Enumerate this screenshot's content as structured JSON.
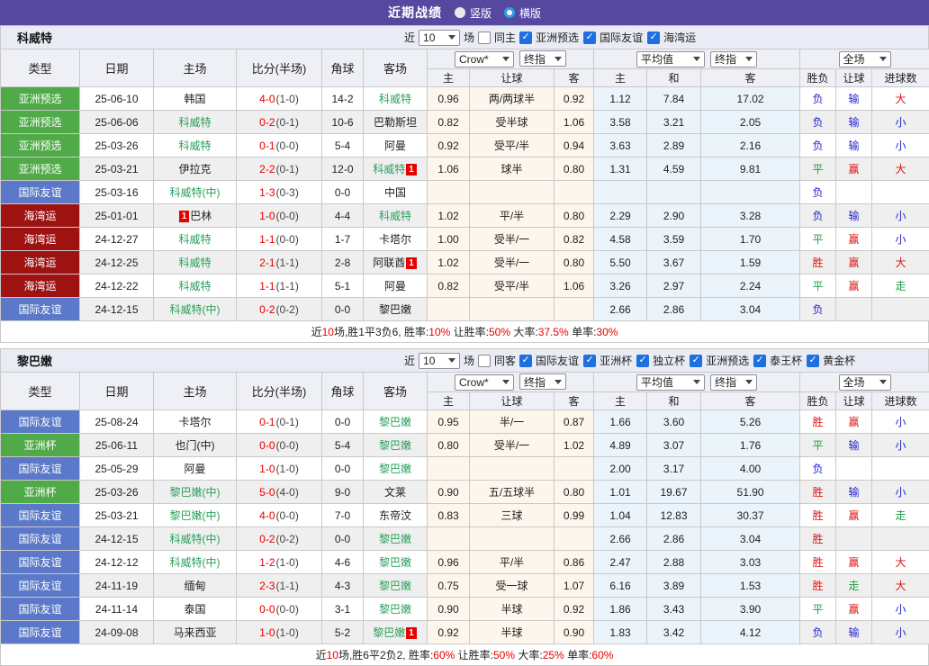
{
  "title_bar": {
    "title": "近期战绩",
    "radio_vertical": "竖版",
    "radio_horizontal": "横版"
  },
  "filter_labels": {
    "near": "近",
    "count": "10",
    "games": "场"
  },
  "column_headers": {
    "main": [
      "类型",
      "日期",
      "主场",
      "比分(半场)",
      "角球",
      "客场"
    ],
    "sub": [
      "主",
      "让球",
      "客",
      "主",
      "和",
      "客",
      "胜负",
      "让球",
      "进球数"
    ]
  },
  "dropdowns": {
    "book": "Crow*",
    "book_final": "终指",
    "avg": "平均值",
    "avg_final": "终指",
    "scope": "全场"
  },
  "tables": [
    {
      "team": "科威特",
      "same_label": "同主",
      "competitions": [
        "亚洲预选",
        "国际友谊",
        "海湾运"
      ],
      "rows": [
        {
          "type": "亚洲预选",
          "type_color": "green",
          "date": "25-06-10",
          "home": "韩国",
          "home_green": false,
          "home_badge_pre": "",
          "home_badge_post": "",
          "score": "4-0",
          "half": "(1-0)",
          "corner": "14-2",
          "away": "科威特",
          "away_green": true,
          "away_badge_pre": "",
          "away_badge_post": "",
          "odds_home": "0.96",
          "odds_handicap": "两/两球半",
          "odds_away": "0.92",
          "avg_home": "1.12",
          "avg_draw": "7.84",
          "avg_away": "17.02",
          "result": "负",
          "result_color": "blue",
          "handicap_result": "输",
          "handicap_result_color": "blue",
          "goals": "大",
          "goals_color": "red"
        },
        {
          "type": "亚洲预选",
          "type_color": "green",
          "date": "25-06-06",
          "home": "科威特",
          "home_green": true,
          "home_badge_pre": "",
          "home_badge_post": "",
          "score": "0-2",
          "half": "(0-1)",
          "corner": "10-6",
          "away": "巴勒斯坦",
          "away_green": false,
          "away_badge_pre": "",
          "away_badge_post": "",
          "odds_home": "0.82",
          "odds_handicap": "受半球",
          "odds_away": "1.06",
          "avg_home": "3.58",
          "avg_draw": "3.21",
          "avg_away": "2.05",
          "result": "负",
          "result_color": "blue",
          "handicap_result": "输",
          "handicap_result_color": "blue",
          "goals": "小",
          "goals_color": "blue"
        },
        {
          "type": "亚洲预选",
          "type_color": "green",
          "date": "25-03-26",
          "home": "科威特",
          "home_green": true,
          "home_badge_pre": "",
          "home_badge_post": "",
          "score": "0-1",
          "half": "(0-0)",
          "corner": "5-4",
          "away": "阿曼",
          "away_green": false,
          "away_badge_pre": "",
          "away_badge_post": "",
          "odds_home": "0.92",
          "odds_handicap": "受平/半",
          "odds_away": "0.94",
          "avg_home": "3.63",
          "avg_draw": "2.89",
          "avg_away": "2.16",
          "result": "负",
          "result_color": "blue",
          "handicap_result": "输",
          "handicap_result_color": "blue",
          "goals": "小",
          "goals_color": "blue"
        },
        {
          "type": "亚洲预选",
          "type_color": "green",
          "date": "25-03-21",
          "home": "伊拉克",
          "home_green": false,
          "home_badge_pre": "",
          "home_badge_post": "",
          "score": "2-2",
          "half": "(0-1)",
          "corner": "12-0",
          "away": "科威特",
          "away_green": true,
          "away_badge_pre": "",
          "away_badge_post": "1",
          "odds_home": "1.06",
          "odds_handicap": "球半",
          "odds_away": "0.80",
          "avg_home": "1.31",
          "avg_draw": "4.59",
          "avg_away": "9.81",
          "result": "平",
          "result_color": "green",
          "handicap_result": "赢",
          "handicap_result_color": "red",
          "goals": "大",
          "goals_color": "red"
        },
        {
          "type": "国际友谊",
          "type_color": "blue",
          "date": "25-03-16",
          "home": "科威特(中)",
          "home_green": true,
          "home_badge_pre": "",
          "home_badge_post": "",
          "score": "1-3",
          "half": "(0-3)",
          "corner": "0-0",
          "away": "中国",
          "away_green": false,
          "away_badge_pre": "",
          "away_badge_post": "",
          "odds_home": "",
          "odds_handicap": "",
          "odds_away": "",
          "avg_home": "",
          "avg_draw": "",
          "avg_away": "",
          "result": "负",
          "result_color": "blue",
          "handicap_result": "",
          "handicap_result_color": "blue",
          "goals": "",
          "goals_color": "blue"
        },
        {
          "type": "海湾运",
          "type_color": "darkred",
          "date": "25-01-01",
          "home": "巴林",
          "home_green": false,
          "home_badge_pre": "1",
          "home_badge_post": "",
          "score": "1-0",
          "half": "(0-0)",
          "corner": "4-4",
          "away": "科威特",
          "away_green": true,
          "away_badge_pre": "",
          "away_badge_post": "",
          "odds_home": "1.02",
          "odds_handicap": "平/半",
          "odds_away": "0.80",
          "avg_home": "2.29",
          "avg_draw": "2.90",
          "avg_away": "3.28",
          "result": "负",
          "result_color": "blue",
          "handicap_result": "输",
          "handicap_result_color": "blue",
          "goals": "小",
          "goals_color": "blue"
        },
        {
          "type": "海湾运",
          "type_color": "darkred",
          "date": "24-12-27",
          "home": "科威特",
          "home_green": true,
          "home_badge_pre": "",
          "home_badge_post": "",
          "score": "1-1",
          "half": "(0-0)",
          "corner": "1-7",
          "away": "卡塔尔",
          "away_green": false,
          "away_badge_pre": "",
          "away_badge_post": "",
          "odds_home": "1.00",
          "odds_handicap": "受半/一",
          "odds_away": "0.82",
          "avg_home": "4.58",
          "avg_draw": "3.59",
          "avg_away": "1.70",
          "result": "平",
          "result_color": "green",
          "handicap_result": "赢",
          "handicap_result_color": "red",
          "goals": "小",
          "goals_color": "blue"
        },
        {
          "type": "海湾运",
          "type_color": "darkred",
          "date": "24-12-25",
          "home": "科威特",
          "home_green": true,
          "home_badge_pre": "",
          "home_badge_post": "",
          "score": "2-1",
          "half": "(1-1)",
          "corner": "2-8",
          "away": "阿联酋",
          "away_green": false,
          "away_badge_pre": "",
          "away_badge_post": "1",
          "odds_home": "1.02",
          "odds_handicap": "受半/一",
          "odds_away": "0.80",
          "avg_home": "5.50",
          "avg_draw": "3.67",
          "avg_away": "1.59",
          "result": "胜",
          "result_color": "red",
          "handicap_result": "赢",
          "handicap_result_color": "red",
          "goals": "大",
          "goals_color": "red"
        },
        {
          "type": "海湾运",
          "type_color": "darkred",
          "date": "24-12-22",
          "home": "科威特",
          "home_green": true,
          "home_badge_pre": "",
          "home_badge_post": "",
          "score": "1-1",
          "half": "(1-1)",
          "corner": "5-1",
          "away": "阿曼",
          "away_green": false,
          "away_badge_pre": "",
          "away_badge_post": "",
          "odds_home": "0.82",
          "odds_handicap": "受平/半",
          "odds_away": "1.06",
          "avg_home": "3.26",
          "avg_draw": "2.97",
          "avg_away": "2.24",
          "result": "平",
          "result_color": "green",
          "handicap_result": "赢",
          "handicap_result_color": "red",
          "goals": "走",
          "goals_color": "green"
        },
        {
          "type": "国际友谊",
          "type_color": "blue",
          "date": "24-12-15",
          "home": "科威特(中)",
          "home_green": true,
          "home_badge_pre": "",
          "home_badge_post": "",
          "score": "0-2",
          "half": "(0-2)",
          "corner": "0-0",
          "away": "黎巴嫩",
          "away_green": false,
          "away_badge_pre": "",
          "away_badge_post": "",
          "odds_home": "",
          "odds_handicap": "",
          "odds_away": "",
          "avg_home": "2.66",
          "avg_draw": "2.86",
          "avg_away": "3.04",
          "result": "负",
          "result_color": "blue",
          "handicap_result": "",
          "handicap_result_color": "blue",
          "goals": "",
          "goals_color": "blue"
        }
      ],
      "summary": [
        {
          "t": "近",
          "c": "k"
        },
        {
          "t": "10",
          "c": "r"
        },
        {
          "t": "场,胜1平3负6, 胜率:",
          "c": "k"
        },
        {
          "t": "10%",
          "c": "r"
        },
        {
          "t": " 让胜率:",
          "c": "k"
        },
        {
          "t": "50%",
          "c": "r"
        },
        {
          "t": " 大率:",
          "c": "k"
        },
        {
          "t": "37.5%",
          "c": "r"
        },
        {
          "t": " 单率:",
          "c": "k"
        },
        {
          "t": "30%",
          "c": "r"
        }
      ]
    },
    {
      "team": "黎巴嫩",
      "same_label": "同客",
      "competitions": [
        "国际友谊",
        "亚洲杯",
        "独立杯",
        "亚洲预选",
        "泰王杯",
        "黄金杯"
      ],
      "rows": [
        {
          "type": "国际友谊",
          "type_color": "blue",
          "date": "25-08-24",
          "home": "卡塔尔",
          "home_green": false,
          "home_badge_pre": "",
          "home_badge_post": "",
          "score": "0-1",
          "half": "(0-1)",
          "corner": "0-0",
          "away": "黎巴嫩",
          "away_green": true,
          "away_badge_pre": "",
          "away_badge_post": "",
          "odds_home": "0.95",
          "odds_handicap": "半/一",
          "odds_away": "0.87",
          "avg_home": "1.66",
          "avg_draw": "3.60",
          "avg_away": "5.26",
          "result": "胜",
          "result_color": "red",
          "handicap_result": "赢",
          "handicap_result_color": "red",
          "goals": "小",
          "goals_color": "blue"
        },
        {
          "type": "亚洲杯",
          "type_color": "green",
          "date": "25-06-11",
          "home": "也门(中)",
          "home_green": false,
          "home_badge_pre": "",
          "home_badge_post": "",
          "score": "0-0",
          "half": "(0-0)",
          "corner": "5-4",
          "away": "黎巴嫩",
          "away_green": true,
          "away_badge_pre": "",
          "away_badge_post": "",
          "odds_home": "0.80",
          "odds_handicap": "受半/一",
          "odds_away": "1.02",
          "avg_home": "4.89",
          "avg_draw": "3.07",
          "avg_away": "1.76",
          "result": "平",
          "result_color": "green",
          "handicap_result": "输",
          "handicap_result_color": "blue",
          "goals": "小",
          "goals_color": "blue"
        },
        {
          "type": "国际友谊",
          "type_color": "blue",
          "date": "25-05-29",
          "home": "阿曼",
          "home_green": false,
          "home_badge_pre": "",
          "home_badge_post": "",
          "score": "1-0",
          "half": "(1-0)",
          "corner": "0-0",
          "away": "黎巴嫩",
          "away_green": true,
          "away_badge_pre": "",
          "away_badge_post": "",
          "odds_home": "",
          "odds_handicap": "",
          "odds_away": "",
          "avg_home": "2.00",
          "avg_draw": "3.17",
          "avg_away": "4.00",
          "result": "负",
          "result_color": "blue",
          "handicap_result": "",
          "handicap_result_color": "blue",
          "goals": "",
          "goals_color": "blue"
        },
        {
          "type": "亚洲杯",
          "type_color": "green",
          "date": "25-03-26",
          "home": "黎巴嫩(中)",
          "home_green": true,
          "home_badge_pre": "",
          "home_badge_post": "",
          "score": "5-0",
          "half": "(4-0)",
          "corner": "9-0",
          "away": "文莱",
          "away_green": false,
          "away_badge_pre": "",
          "away_badge_post": "",
          "odds_home": "0.90",
          "odds_handicap": "五/五球半",
          "odds_away": "0.80",
          "avg_home": "1.01",
          "avg_draw": "19.67",
          "avg_away": "51.90",
          "result": "胜",
          "result_color": "red",
          "handicap_result": "输",
          "handicap_result_color": "blue",
          "goals": "小",
          "goals_color": "blue"
        },
        {
          "type": "国际友谊",
          "type_color": "blue",
          "date": "25-03-21",
          "home": "黎巴嫩(中)",
          "home_green": true,
          "home_badge_pre": "",
          "home_badge_post": "",
          "score": "4-0",
          "half": "(0-0)",
          "corner": "7-0",
          "away": "东帝汶",
          "away_green": false,
          "away_badge_pre": "",
          "away_badge_post": "",
          "odds_home": "0.83",
          "odds_handicap": "三球",
          "odds_away": "0.99",
          "avg_home": "1.04",
          "avg_draw": "12.83",
          "avg_away": "30.37",
          "result": "胜",
          "result_color": "red",
          "handicap_result": "赢",
          "handicap_result_color": "red",
          "goals": "走",
          "goals_color": "green"
        },
        {
          "type": "国际友谊",
          "type_color": "blue",
          "date": "24-12-15",
          "home": "科威特(中)",
          "home_green": true,
          "home_badge_pre": "",
          "home_badge_post": "",
          "score": "0-2",
          "half": "(0-2)",
          "corner": "0-0",
          "away": "黎巴嫩",
          "away_green": true,
          "away_badge_pre": "",
          "away_badge_post": "",
          "odds_home": "",
          "odds_handicap": "",
          "odds_away": "",
          "avg_home": "2.66",
          "avg_draw": "2.86",
          "avg_away": "3.04",
          "result": "胜",
          "result_color": "red",
          "handicap_result": "",
          "handicap_result_color": "blue",
          "goals": "",
          "goals_color": "blue"
        },
        {
          "type": "国际友谊",
          "type_color": "blue",
          "date": "24-12-12",
          "home": "科威特(中)",
          "home_green": true,
          "home_badge_pre": "",
          "home_badge_post": "",
          "score": "1-2",
          "half": "(1-0)",
          "corner": "4-6",
          "away": "黎巴嫩",
          "away_green": true,
          "away_badge_pre": "",
          "away_badge_post": "",
          "odds_home": "0.96",
          "odds_handicap": "平/半",
          "odds_away": "0.86",
          "avg_home": "2.47",
          "avg_draw": "2.88",
          "avg_away": "3.03",
          "result": "胜",
          "result_color": "red",
          "handicap_result": "赢",
          "handicap_result_color": "red",
          "goals": "大",
          "goals_color": "red"
        },
        {
          "type": "国际友谊",
          "type_color": "blue",
          "date": "24-11-19",
          "home": "缅甸",
          "home_green": false,
          "home_badge_pre": "",
          "home_badge_post": "",
          "score": "2-3",
          "half": "(1-1)",
          "corner": "4-3",
          "away": "黎巴嫩",
          "away_green": true,
          "away_badge_pre": "",
          "away_badge_post": "",
          "odds_home": "0.75",
          "odds_handicap": "受一球",
          "odds_away": "1.07",
          "avg_home": "6.16",
          "avg_draw": "3.89",
          "avg_away": "1.53",
          "result": "胜",
          "result_color": "red",
          "handicap_result": "走",
          "handicap_result_color": "green",
          "goals": "大",
          "goals_color": "red"
        },
        {
          "type": "国际友谊",
          "type_color": "blue",
          "date": "24-11-14",
          "home": "泰国",
          "home_green": false,
          "home_badge_pre": "",
          "home_badge_post": "",
          "score": "0-0",
          "half": "(0-0)",
          "corner": "3-1",
          "away": "黎巴嫩",
          "away_green": true,
          "away_badge_pre": "",
          "away_badge_post": "",
          "odds_home": "0.90",
          "odds_handicap": "半球",
          "odds_away": "0.92",
          "avg_home": "1.86",
          "avg_draw": "3.43",
          "avg_away": "3.90",
          "result": "平",
          "result_color": "green",
          "handicap_result": "赢",
          "handicap_result_color": "red",
          "goals": "小",
          "goals_color": "blue"
        },
        {
          "type": "国际友谊",
          "type_color": "blue",
          "date": "24-09-08",
          "home": "马来西亚",
          "home_green": false,
          "home_badge_pre": "",
          "home_badge_post": "",
          "score": "1-0",
          "half": "(1-0)",
          "corner": "5-2",
          "away": "黎巴嫩",
          "away_green": true,
          "away_badge_pre": "",
          "away_badge_post": "1",
          "odds_home": "0.92",
          "odds_handicap": "半球",
          "odds_away": "0.90",
          "avg_home": "1.83",
          "avg_draw": "3.42",
          "avg_away": "4.12",
          "result": "负",
          "result_color": "blue",
          "handicap_result": "输",
          "handicap_result_color": "blue",
          "goals": "小",
          "goals_color": "blue"
        }
      ],
      "summary": [
        {
          "t": "近",
          "c": "k"
        },
        {
          "t": "10",
          "c": "r"
        },
        {
          "t": "场,胜6平2负2, 胜率:",
          "c": "k"
        },
        {
          "t": "60%",
          "c": "r"
        },
        {
          "t": " 让胜率:",
          "c": "k"
        },
        {
          "t": "50%",
          "c": "r"
        },
        {
          "t": " 大率:",
          "c": "k"
        },
        {
          "t": "25%",
          "c": "r"
        },
        {
          "t": " 单率:",
          "c": "k"
        },
        {
          "t": "60%",
          "c": "r"
        }
      ]
    }
  ]
}
